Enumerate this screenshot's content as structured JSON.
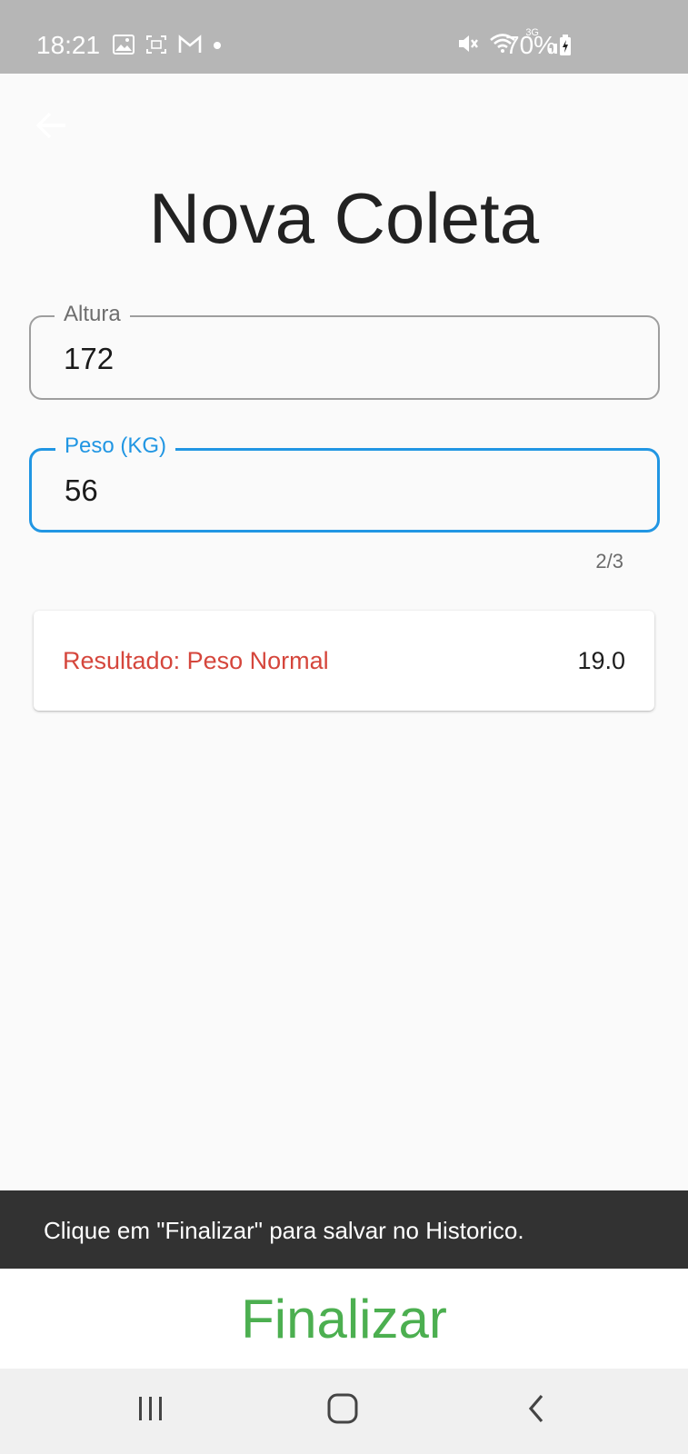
{
  "status_bar": {
    "time": "18:21",
    "network": "3G",
    "battery": "70%",
    "icons": [
      "gallery-icon",
      "screenshot-icon",
      "gmail-icon",
      "notification-dot-icon",
      "mute-icon",
      "wifi-icon",
      "signal-icon",
      "battery-charging-icon"
    ]
  },
  "app_bar": {
    "back_icon": "arrow-left-icon"
  },
  "page": {
    "title": "Nova Coleta"
  },
  "form": {
    "altura": {
      "label": "Altura",
      "value": "172"
    },
    "peso": {
      "label": "Peso (KG)",
      "value": "56",
      "counter": "2/3"
    }
  },
  "result": {
    "label": "Resultado: Peso Normal",
    "value": "19.0"
  },
  "snackbar": {
    "message": "Clique em \"Finalizar\" para salvar no Historico."
  },
  "actions": {
    "finalize_label": "Finalizar"
  },
  "nav_bar": {
    "icons": [
      "recents-icon",
      "home-icon",
      "back-icon"
    ]
  },
  "colors": {
    "status_bar": "#b6b6b6",
    "focus_blue": "#2196e3",
    "result_red": "#d5463c",
    "finalize_green": "#4caf50",
    "snackbar": "#323232"
  }
}
